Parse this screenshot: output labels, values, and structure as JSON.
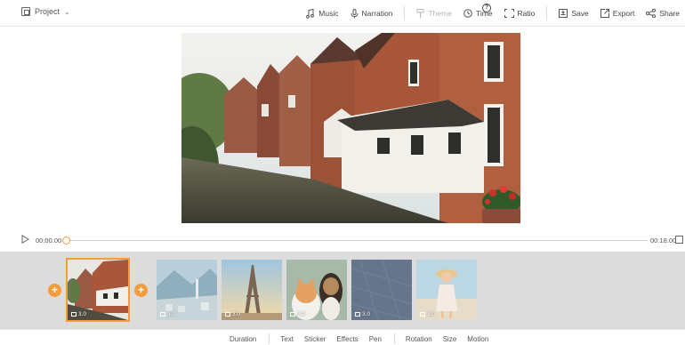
{
  "topbar": {
    "project_label": "Project",
    "tools": [
      {
        "label": "Music",
        "icon": "music-icon",
        "disabled": false
      },
      {
        "label": "Narration",
        "icon": "microphone-icon",
        "disabled": false
      },
      {
        "label": "Theme",
        "icon": "theme-icon",
        "disabled": true
      },
      {
        "label": "Time",
        "icon": "clock-icon",
        "disabled": false
      },
      {
        "label": "Ratio",
        "icon": "ratio-icon",
        "disabled": false
      },
      {
        "label": "Save",
        "icon": "save-icon",
        "disabled": false
      },
      {
        "label": "Export",
        "icon": "export-icon",
        "disabled": false
      },
      {
        "label": "Share",
        "icon": "share-icon",
        "disabled": false
      }
    ],
    "help_glyph": "?"
  },
  "player": {
    "current_time": "00:00.00",
    "total_time": "00:18.00",
    "progress": 0
  },
  "clips": [
    {
      "duration": "3.0",
      "subject": "canal-houses",
      "selected": true
    },
    {
      "duration": "3.0",
      "subject": "mountain-village",
      "selected": false
    },
    {
      "duration": "3.0",
      "subject": "eiffel-tower",
      "selected": false
    },
    {
      "duration": "3.0",
      "subject": "cat-and-dog",
      "selected": false
    },
    {
      "duration": "3.0",
      "subject": "blue-texture",
      "selected": false
    },
    {
      "duration": "3.0",
      "subject": "girl-on-beach",
      "selected": false
    }
  ],
  "bottom_tabs": {
    "duration": "Duration",
    "text": "Text",
    "sticker": "Sticker",
    "effects": "Effects",
    "pen": "Pen",
    "rotation": "Rotation",
    "size": "Size",
    "motion": "Motion"
  },
  "colors": {
    "accent": "#f39c3c",
    "strip_bg": "#dcdcdc"
  }
}
